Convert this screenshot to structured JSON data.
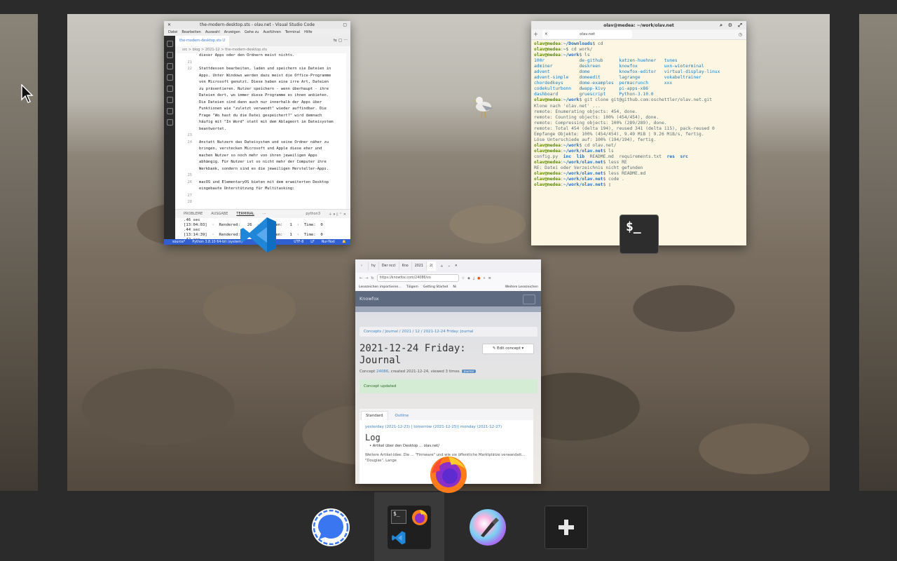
{
  "workspace": {
    "note": ""
  },
  "vscode": {
    "title": "the-modern-desktop.sts - olav.net - Visual Studio Code",
    "menu": [
      "Datei",
      "Bearbeiten",
      "Auswahl",
      "Anzeigen",
      "Gehe zu",
      "Ausführen",
      "Terminal",
      "Hilfe"
    ],
    "tab": "the-modern-desktop.sts U",
    "breadcrumb": "src > blog > 2021-12 > the-modern-desktop.sts",
    "code_lines": [
      {
        "n": "",
        "t": "dieser Apps oder den Ordnern meist nichts."
      },
      {
        "n": "21",
        "t": ""
      },
      {
        "n": "22",
        "t": "Stattdessen bearbeiten, laden und speichern sie Dateien in"
      },
      {
        "n": "",
        "t": "Apps. Unter Windows werden dazu meist die Office-Programme"
      },
      {
        "n": "",
        "t": "von Microsoft genutzt. Diese haben eine irre Art, Dateien"
      },
      {
        "n": "",
        "t": "zu präsentieren. Nutzer speichern - wenn überhaupt - ihre"
      },
      {
        "n": "",
        "t": "Dateien dort, wo immer diese Programme es ihnen anbieten."
      },
      {
        "n": "",
        "t": "Die Dateien sind dann auch nur innerhalb der Apps über"
      },
      {
        "n": "",
        "t": "Funktionen wie \"zuletzt verwandt\" wieder auffindbar. Die"
      },
      {
        "n": "",
        "t": "Frage \"Wo hast du die Datei gespeichert?\" wird demnach"
      },
      {
        "n": "",
        "t": "häufig mit \"In Word\" statt mit dem Ablageort im Dateisystem"
      },
      {
        "n": "",
        "t": "beantwortet."
      },
      {
        "n": "23",
        "t": ""
      },
      {
        "n": "24",
        "t": "Anstatt Nutzern das Dateisystem und seine Ordner näher zu"
      },
      {
        "n": "",
        "t": "bringen, verstecken Microsoft und Apple diese eher und"
      },
      {
        "n": "",
        "t": "machen Nutzer so noch mehr von ihren jeweiligen Apps"
      },
      {
        "n": "",
        "t": "abhängig. Für Nutzer ist so nicht mehr der Computer ihre"
      },
      {
        "n": "",
        "t": "Werkbank, sondern sind es die jeweiligen Hersteller-Apps."
      },
      {
        "n": "25",
        "t": ""
      },
      {
        "n": "26",
        "t": "macOS und ElementaryOS bieten mit dem erweiterten Desktop"
      },
      {
        "n": "",
        "t": "eingebaute Unterstützung für Multitasking:"
      },
      {
        "n": "27",
        "t": ""
      },
      {
        "n": "28",
        "t": ""
      }
    ],
    "panel_tabs": [
      "PROBLEME",
      "AUSGABE",
      "TERMINAL",
      "···"
    ],
    "panel_shell": "python3",
    "terminal_lines": [
      ".46 sec",
      "[13:04:03]  ·  Rendered:   26  ·  Written:   1  ·  Time:  0",
      ".44 sec",
      "[13:14:39]  ·  Rendered:   26  ·  Written:   1  ·  Time:  0",
      ".42 sec",
      "[13:25:37]  ·  Rendered:   26  ·  Written:   1  ·  Time:  0",
      ".42 sec",
      "▯"
    ],
    "status": [
      "source*",
      "Python 3.8.10 64-bit (system)",
      "UTF-8",
      "LF",
      "Nur-Text"
    ]
  },
  "terminal": {
    "title": "olav@medea: ~/work/olav.net",
    "tab": "olav.net",
    "lines": [
      [
        {
          "c": "g",
          "t": "olav@medea"
        },
        {
          "c": "",
          "t": ":"
        },
        {
          "c": "b",
          "t": "~/Downloads"
        },
        {
          "c": "",
          "t": "$ cd"
        }
      ],
      [
        {
          "c": "g",
          "t": "olav@medea"
        },
        {
          "c": "",
          "t": ":"
        },
        {
          "c": "b",
          "t": "~"
        },
        {
          "c": "",
          "t": "$ cd work/"
        }
      ],
      [
        {
          "c": "g",
          "t": "olav@medea"
        },
        {
          "c": "",
          "t": ":"
        },
        {
          "c": "b",
          "t": "~/work"
        },
        {
          "c": "",
          "t": "$ ls"
        }
      ],
      [
        {
          "c": "cy",
          "t": "100r             de-github      katzen-huehner   tunes"
        }
      ],
      [
        {
          "c": "cy",
          "t": "adminer          deskreen       knowfox          uxn-wioterminal"
        }
      ],
      [
        {
          "c": "cy",
          "t": "advent           dome           knowfox-editor   virtual-display-linux"
        }
      ],
      [
        {
          "c": "cy",
          "t": "advent-simple    domeedit       lagrange         vokabeltrainer"
        }
      ],
      [
        {
          "c": "cy",
          "t": "chordedkeys      dome-examples  permacrunch      xxx"
        }
      ],
      [
        {
          "c": "cy",
          "t": "codekulturbonn   dwapp-kivy     pi-apps-x86"
        }
      ],
      [
        {
          "c": "cy",
          "t": "dashboard        gruescript     Python-3.10.0"
        }
      ],
      [
        {
          "c": "g",
          "t": "olav@medea"
        },
        {
          "c": "",
          "t": ":"
        },
        {
          "c": "b",
          "t": "~/work"
        },
        {
          "c": "",
          "t": "$ git clone git@github.com:oschettler/olav.net.git"
        }
      ],
      [
        {
          "c": "",
          "t": "Klone nach 'olav.net' ..."
        }
      ],
      [
        {
          "c": "",
          "t": "remote: Enumerating objects: 454, done."
        }
      ],
      [
        {
          "c": "",
          "t": "remote: Counting objects: 100% (454/454), done."
        }
      ],
      [
        {
          "c": "",
          "t": "remote: Compressing objects: 100% (289/289), done."
        }
      ],
      [
        {
          "c": "",
          "t": "remote: Total 454 (delta 194), reused 341 (delta 115), pack-reused 0"
        }
      ],
      [
        {
          "c": "",
          "t": "Empfange Objekte: 100% (454/454), 9.49 MiB | 9.26 MiB/s, fertig."
        }
      ],
      [
        {
          "c": "",
          "t": "Löse Unterschiede auf: 100% (194/194), fertig."
        }
      ],
      [
        {
          "c": "g",
          "t": "olav@medea"
        },
        {
          "c": "",
          "t": ":"
        },
        {
          "c": "b",
          "t": "~/work"
        },
        {
          "c": "",
          "t": "$ cd olav.net/"
        }
      ],
      [
        {
          "c": "g",
          "t": "olav@medea"
        },
        {
          "c": "",
          "t": ":"
        },
        {
          "c": "b",
          "t": "~/work/olav.net"
        },
        {
          "c": "",
          "t": "$ ls"
        }
      ],
      [
        {
          "c": "",
          "t": "config.py  "
        },
        {
          "c": "b",
          "t": "inc  lib"
        },
        {
          "c": "",
          "t": "  README.md  requirements.txt  "
        },
        {
          "c": "b",
          "t": "res  src"
        }
      ],
      [
        {
          "c": "g",
          "t": "olav@medea"
        },
        {
          "c": "",
          "t": ":"
        },
        {
          "c": "b",
          "t": "~/work/olav.net"
        },
        {
          "c": "",
          "t": "$ less RE"
        }
      ],
      [
        {
          "c": "",
          "t": "RE: Datei oder Verzeichnis nicht gefunden"
        }
      ],
      [
        {
          "c": "g",
          "t": "olav@medea"
        },
        {
          "c": "",
          "t": ":"
        },
        {
          "c": "b",
          "t": "~/work/olav.net"
        },
        {
          "c": "",
          "t": "$ less README.md"
        }
      ],
      [
        {
          "c": "g",
          "t": "olav@medea"
        },
        {
          "c": "",
          "t": ":"
        },
        {
          "c": "b",
          "t": "~/work/olav.net"
        },
        {
          "c": "",
          "t": "$ code ."
        }
      ],
      [
        {
          "c": "g",
          "t": "olav@medea"
        },
        {
          "c": "",
          "t": ":"
        },
        {
          "c": "b",
          "t": "~/work/olav.net"
        },
        {
          "c": "",
          "t": "$ ▯"
        }
      ]
    ]
  },
  "firefox": {
    "tabs": [
      "hy",
      "Der nccl",
      "Kno",
      "2021",
      "2("
    ],
    "url": "https://knowfox.com/24086/vo",
    "bookmarks": [
      "Lesezeichen importieren...",
      "Tiögem",
      "Getting Started",
      "Ni",
      "Weitere Lesezeichen"
    ],
    "site_name": "Knowfox",
    "breadcrumb": "Concepts   /   Journal   /   2021   /   12   /   2021-12-24 Friday: Journal",
    "title_line1": "2021-12-24 Friday:",
    "title_line2": "Journal",
    "edit_button": "Edit concept",
    "meta_prefix": "Concept ",
    "meta_link": "24086",
    "meta_suffix": ", created 2021-12-24, viewed 3 times.",
    "meta_badge": "Journal",
    "alert": "Concept updated",
    "card_tabs": [
      "Standard",
      "Outline"
    ],
    "links": "yesterday (2021-12-23) | tomorrow (2021-12-25)| monday (2021-12-27)",
    "heading": "Log",
    "list_item": "Artikel über den Desktop ... olav.net/",
    "paragraph": "Weitere Artikel-Idee: Die ... \"Firmware\" und wie sie öffentliche Marktplätze verwandelt... \"Douglas\". Lange"
  },
  "floating_badges": [
    "vscode-app-icon",
    "terminal-app-icon",
    "firefox-app-icon"
  ],
  "terminal_badge_text": "$_",
  "dock": {
    "items": [
      "signal",
      "current-workspace",
      "color-picker",
      "add-workspace"
    ],
    "current_workspace_terminal_text": "$_"
  },
  "colors": {
    "vscode_status": "#2f5fd0",
    "terminal_bg": "#fdf6e3",
    "dock_bg": "#2b2b2b",
    "signal_blue": "#3a76f0"
  }
}
